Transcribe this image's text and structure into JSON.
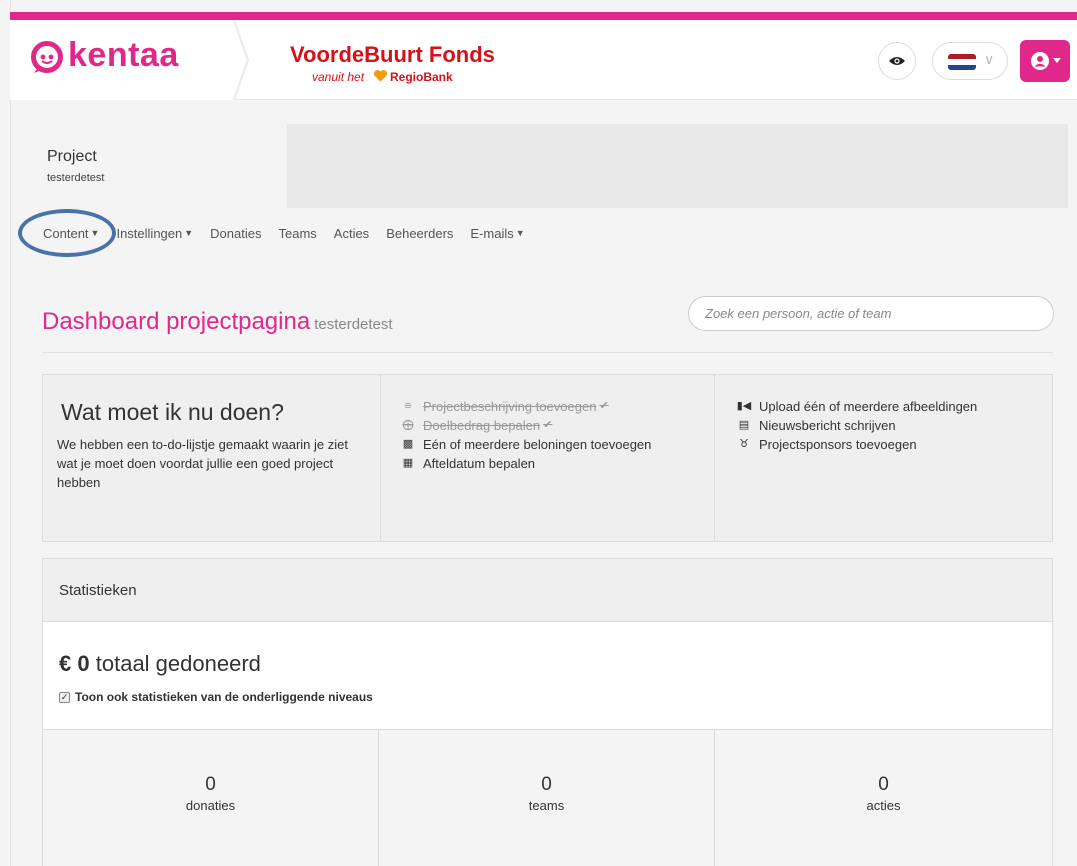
{
  "header": {
    "logo_text": "kentaa",
    "brand_title": "VoordeBuurt Fonds",
    "brand_sub": "vanuit het",
    "brand_bank": "RegioBank",
    "preview_icon": "eye-icon",
    "language_flag": "nl-flag",
    "user_icon": "user-icon",
    "accent_color": "#e0288a"
  },
  "project": {
    "label": "Project",
    "name": "testerdetest"
  },
  "nav": {
    "items": [
      {
        "label": "Content",
        "has_dropdown": true
      },
      {
        "label": "Instellingen",
        "has_dropdown": true
      },
      {
        "label": "Donaties",
        "has_dropdown": false
      },
      {
        "label": "Teams",
        "has_dropdown": false
      },
      {
        "label": "Acties",
        "has_dropdown": false
      },
      {
        "label": "Beheerders",
        "has_dropdown": false
      },
      {
        "label": "E-mails",
        "has_dropdown": true
      }
    ]
  },
  "dashboard": {
    "title": "Dashboard projectpagina",
    "subtitle": "testerdetest",
    "search_placeholder": "Zoek een persoon, actie of team"
  },
  "todo": {
    "heading": "Wat moet ik nu doen?",
    "description": "We hebben een to-do-lijstje gemaakt waarin je ziet wat je moet doen voordat jullie een goed project hebben",
    "tasks_a": [
      {
        "label": "Projectbeschrijving toevoegen",
        "done": true,
        "icon": "align-left-icon"
      },
      {
        "label": "Doelbedrag bepalen",
        "done": true,
        "icon": "crosshairs-icon"
      },
      {
        "label": "Eén of meerdere beloningen toevoegen",
        "done": false,
        "icon": "gift-icon"
      },
      {
        "label": "Afteldatum bepalen",
        "done": false,
        "icon": "calendar-icon"
      }
    ],
    "tasks_b": [
      {
        "label": "Upload één of meerdere afbeeldingen",
        "done": false,
        "icon": "video-camera-icon"
      },
      {
        "label": "Nieuwsbericht schrijven",
        "done": false,
        "icon": "newspaper-icon"
      },
      {
        "label": "Projectsponsors toevoegen",
        "done": false,
        "icon": "sponsor-icon"
      }
    ]
  },
  "stats": {
    "title": "Statistieken",
    "currency": "€",
    "total_amount": "0",
    "total_label": "totaal gedoneerd",
    "sub_levels_label": "Toon ook statistieken van de onderliggende niveaus",
    "sub_levels_checked": true,
    "counters": [
      {
        "value": "0",
        "label": "donaties"
      },
      {
        "value": "0",
        "label": "teams"
      },
      {
        "value": "0",
        "label": "acties"
      }
    ]
  }
}
